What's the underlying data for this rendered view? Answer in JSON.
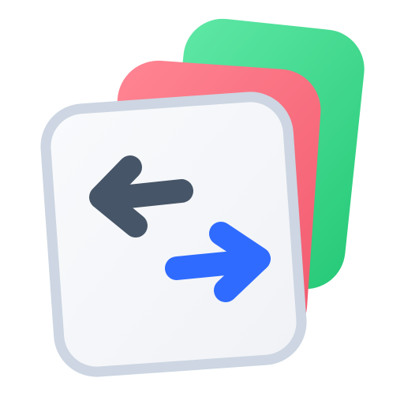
{
  "icon": {
    "name": "swap-documents-app-icon",
    "colors": {
      "green_card_light": "#5FE8A6",
      "green_card_dark": "#26C977",
      "red_card_light": "#FF8593",
      "red_card_dark": "#F25A6E",
      "front_card_fill": "#F9FAFC",
      "front_card_fill_shade": "#F0F2F6",
      "front_card_border": "#CDD6E2",
      "left_arrow": "#465567",
      "right_arrow": "#2F6BFF"
    },
    "arrows": {
      "left": "arrow-left-icon",
      "right": "arrow-right-icon"
    }
  }
}
